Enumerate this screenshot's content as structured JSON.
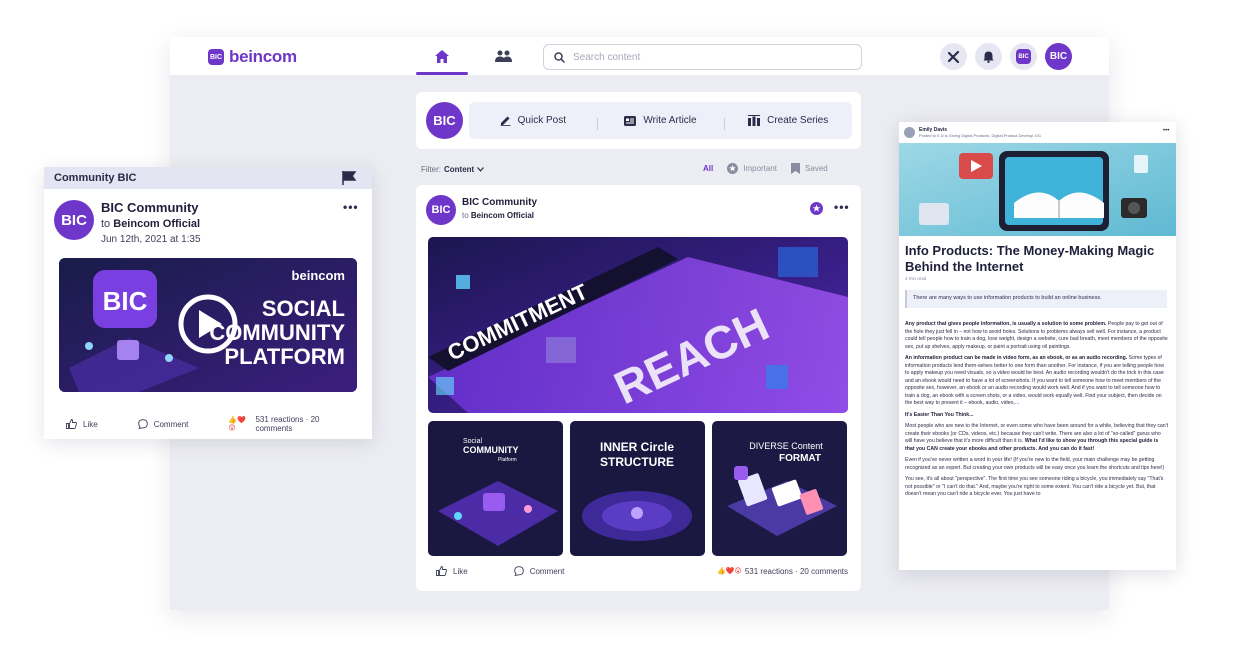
{
  "app": {
    "logo_badge": "BIC",
    "logo_text": "beincom",
    "search_placeholder": "Search content",
    "user_avatar": "BIC",
    "profile_badge": "BIC"
  },
  "composer": {
    "avatar": "BIC",
    "quick_post": "Quick Post",
    "write_article": "Write Article",
    "create_series": "Create Series"
  },
  "filter": {
    "label": "Filter:",
    "value": "Content",
    "tabs": [
      "All",
      "Important",
      "Saved"
    ]
  },
  "post": {
    "avatar": "BIC",
    "author": "BIC Community",
    "to_prefix": "to",
    "to_target": "Beincom Official",
    "hero_words": [
      "COMMITMENT",
      "REACH"
    ],
    "thumbs": [
      {
        "line1": "Social",
        "line2": "COMMUNITY",
        "line3": "Platform"
      },
      {
        "line1": "INNER Circle",
        "line2": "STRUCTURE",
        "line3": ""
      },
      {
        "line1": "DIVERSE Content",
        "line2": "FORMAT",
        "line3": ""
      }
    ],
    "like": "Like",
    "comment": "Comment",
    "reactions": "531 reactions · 20 comments"
  },
  "community_card": {
    "header": "Community BIC",
    "avatar": "BIC",
    "author": "BIC Community",
    "to_prefix": "to",
    "to_target": "Beincom Official",
    "date": "Jun 12th, 2021 at 1:35",
    "video_brand": "beincom",
    "video_logo": "BIC",
    "video_line1": "SOCIAL",
    "video_line2": "COMMUNITY",
    "video_line3": "PLATFORM",
    "like": "Like",
    "comment": "Comment",
    "reactions": "531 reactions · 20 comments"
  },
  "article": {
    "author": "Emily Davis",
    "posted_to": "Posted to E.D is Giving Digital Products, Digital Product Develop 101",
    "title": "Info Products: The Money-Making Magic Behind the Internet",
    "read_time": "4 min read",
    "summary": "There are many ways to use information products to build an online business.",
    "p1_lead": "Any product that gives people information, is usually a solution to some problem.",
    "p1": " People pay to get out of the hole they just fell in – not how to avoid holes. Solutions to problems always sell well. For instance, a product could tell people how to train a dog, lose weight, design a website, cure bad breath, meet members of the opposite sex, put up shelves, apply makeup, or paint a portrait using oil paintings.",
    "p2_lead": "An information product can be made in video form, as an ebook, or as an audio recording.",
    "p2": " Some types of information products lend them-selves better to one form than another. For instance, if you are telling people how to apply makeup you need visuals, so a video would be best. An audio recording wouldn't do the trick in this case and an ebook would need to have a lot of screenshots. If you want to tell someone how to meet members of the opposite sex, however, an ebook or an audio recording would work well. And if you want to tell someone how to train a dog, an ebook with a screen shots, or a video, would work equally well. Find your subject, then decide on the best way to present it – ebook, audio, video,...",
    "h3": "It's Easier Than You Think...",
    "p3": "Most people who are new to the Internet, or even some who have been around for a while, believing that they can't create their ebooks (or CDs, videos, etc.) because they can't write. There are also a lot of \"so-called\" gurus who will have you believe that it's more difficult than it is.",
    "p3_bold": " What I'd like to show you through this special guide is that you CAN create your ebooks and other products. And you can do it fast!",
    "p4": "Even if you've never written a word in your life! (If you're new to the field, your main challenge may be getting recognized as an expert. But creating your own products will be easy once you learn the shortcuts and tips here!)",
    "p5": "You see, it's all about \"perspective\". The first time you see someone riding a bicycle, you immediately say \"That's not possible\" or \"I can't do that.\" And, maybe you're right to some extent. You can't ride a bicycle yet. But, that doesn't mean you can't ride a bicycle ever. You just have to"
  },
  "colors": {
    "brand": "#6f37c9",
    "background": "#ecedf2",
    "action_bg": "#eef0f9"
  }
}
